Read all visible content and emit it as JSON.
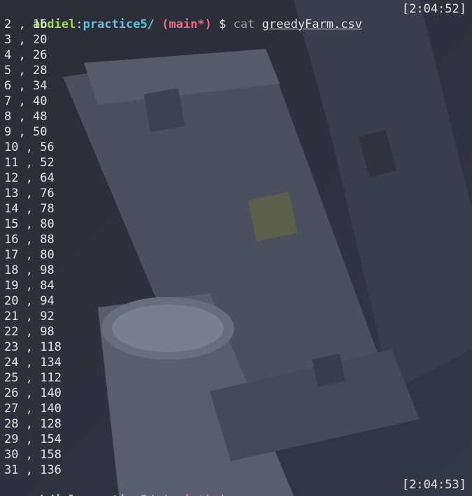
{
  "prompt": {
    "user": "abdiel",
    "colon": ":",
    "path": "practice5/",
    "branch_open": "(",
    "branch": "main*",
    "branch_close": ")",
    "dollar": "$"
  },
  "command": {
    "name": "cat",
    "file": "greedyFarm.csv",
    "timestamp": "[2:04:52]"
  },
  "final_prompt": {
    "timestamp": "[2:04:53]"
  },
  "rows": [
    {
      "a": "2",
      "b": "16"
    },
    {
      "a": "3",
      "b": "20"
    },
    {
      "a": "4",
      "b": "26"
    },
    {
      "a": "5",
      "b": "28"
    },
    {
      "a": "6",
      "b": "34"
    },
    {
      "a": "7",
      "b": "40"
    },
    {
      "a": "8",
      "b": "48"
    },
    {
      "a": "9",
      "b": "50"
    },
    {
      "a": "10",
      "b": "56"
    },
    {
      "a": "11",
      "b": "52"
    },
    {
      "a": "12",
      "b": "64"
    },
    {
      "a": "13",
      "b": "76"
    },
    {
      "a": "14",
      "b": "78"
    },
    {
      "a": "15",
      "b": "80"
    },
    {
      "a": "16",
      "b": "88"
    },
    {
      "a": "17",
      "b": "80"
    },
    {
      "a": "18",
      "b": "98"
    },
    {
      "a": "19",
      "b": "84"
    },
    {
      "a": "20",
      "b": "94"
    },
    {
      "a": "21",
      "b": "92"
    },
    {
      "a": "22",
      "b": "98"
    },
    {
      "a": "23",
      "b": "118"
    },
    {
      "a": "24",
      "b": "134"
    },
    {
      "a": "25",
      "b": "112"
    },
    {
      "a": "26",
      "b": "140"
    },
    {
      "a": "27",
      "b": "140"
    },
    {
      "a": "28",
      "b": "128"
    },
    {
      "a": "29",
      "b": "154"
    },
    {
      "a": "30",
      "b": "158"
    },
    {
      "a": "31",
      "b": "136"
    }
  ],
  "separator": " , ",
  "colors": {
    "background": "#2b2e38",
    "user": "#a3d65c",
    "path": "#5fc3e4",
    "branch": "#ec6b8b",
    "text": "#e6e6e6"
  }
}
